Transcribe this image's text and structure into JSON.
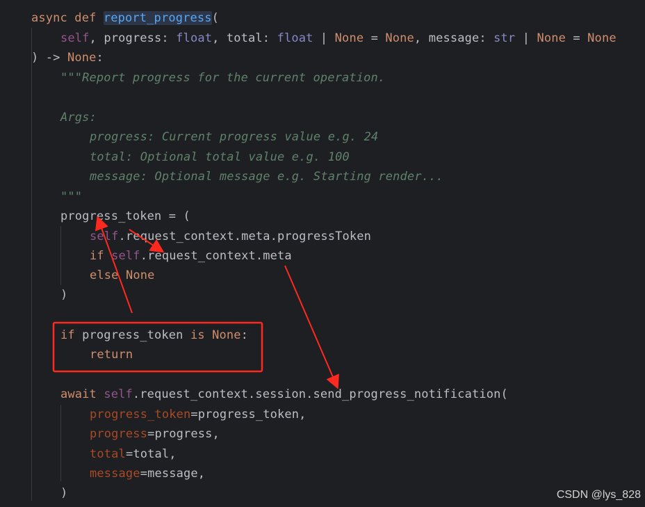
{
  "colors": {
    "background": "#1e1f22",
    "keyword": "#cf8e6d",
    "function_name": "#56a8f5",
    "self": "#94558d",
    "builtin_type": "#8888c6",
    "named_arg": "#aa4926",
    "docstring": "#5f826b",
    "text": "#bcbec4",
    "annotation": "#ff2a1f"
  },
  "code": {
    "line1": {
      "kw": "async def ",
      "fn": "report_progress",
      "rest": "("
    },
    "line2": {
      "self": "self",
      "p1": ", progress: ",
      "t1": "float",
      "p2": ", total: ",
      "t2": "float",
      "p3": " | ",
      "n1": "None",
      "p4": " = ",
      "n2": "None",
      "p5": ", message: ",
      "t3": "str",
      "p6": " | ",
      "n3": "None",
      "p7": " = ",
      "n4": "None"
    },
    "line3": {
      "p1": ") -> ",
      "n1": "None",
      "p2": ":"
    },
    "doc1": "\"\"\"Report progress for the current operation.",
    "doc2": "Args:",
    "doc3": "progress: Current progress value e.g. 24",
    "doc4": "total: Optional total value e.g. 100",
    "doc5": "message: Optional message e.g. Starting render...",
    "doc6": "\"\"\"",
    "line10": "progress_token = (",
    "line11": {
      "self": "self",
      "rest": ".request_context.meta.progressToken"
    },
    "line12": {
      "kw": "if ",
      "self": "self",
      "rest": ".request_context.meta"
    },
    "line13": {
      "kw": "else ",
      "n": "None"
    },
    "line14": ")",
    "line16": {
      "kw1": "if ",
      "p1": "progress_token ",
      "kw2": "is ",
      "n": "None",
      "p2": ":"
    },
    "line17": {
      "kw": "return"
    },
    "line19": {
      "kw": "await ",
      "self": "self",
      "rest": ".request_context.session.send_progress_notification("
    },
    "line20": {
      "arg": "progress_token",
      "rest": "=progress_token,"
    },
    "line21": {
      "arg": "progress",
      "rest": "=progress,"
    },
    "line22": {
      "arg": "total",
      "rest": "=total,"
    },
    "line23": {
      "arg": "message",
      "rest": "=message,"
    },
    "line24": ")"
  },
  "watermark": "CSDN @lys_828"
}
